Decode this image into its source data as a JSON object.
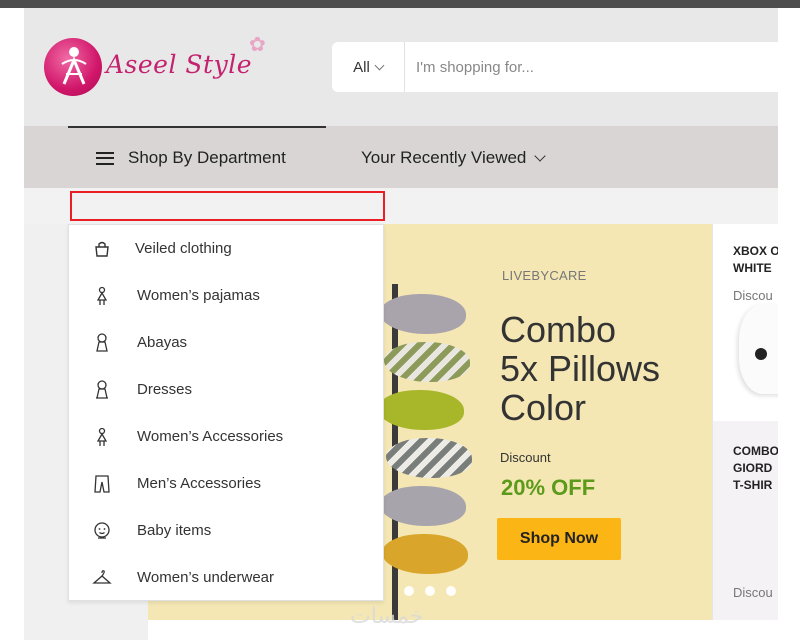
{
  "logo": {
    "text": "Aseel Style"
  },
  "search": {
    "category_label": "All",
    "placeholder": "I'm shopping for..."
  },
  "nav": {
    "department_label": "Shop By Department",
    "recent_label": "Your Recently Viewed"
  },
  "departments": [
    {
      "label": "Veiled clothing",
      "icon": "shopping-bag-icon"
    },
    {
      "label": "Women’s pajamas",
      "icon": "woman-figure-icon"
    },
    {
      "label": "Abayas",
      "icon": "abaya-icon"
    },
    {
      "label": "Dresses",
      "icon": "dress-icon"
    },
    {
      "label": "Women’s Accessories",
      "icon": "woman-figure-icon"
    },
    {
      "label": "Men’s Accessories",
      "icon": "trousers-icon"
    },
    {
      "label": "Baby items",
      "icon": "baby-icon"
    },
    {
      "label": "Women’s underwear",
      "icon": "hanger-icon"
    }
  ],
  "hero": {
    "brand": "LIVEBYCARE",
    "title": "Combo\n5x Pillows\nColor",
    "discount_label": "Discount",
    "discount_value": "20% OFF",
    "cta": "Shop Now",
    "slide_count": 3
  },
  "side_cards": [
    {
      "title": "XBOX O\nWHITE",
      "sub": "Discou"
    },
    {
      "title": "COMBO\nGIORD\nT-SHIR",
      "sub": "Discou"
    }
  ],
  "colors": {
    "accent": "#fbb514",
    "discount": "#5b9a1b",
    "highlight": "#ea1f25",
    "hero_bg": "#f4e7b4",
    "brand": "#c4216f"
  }
}
